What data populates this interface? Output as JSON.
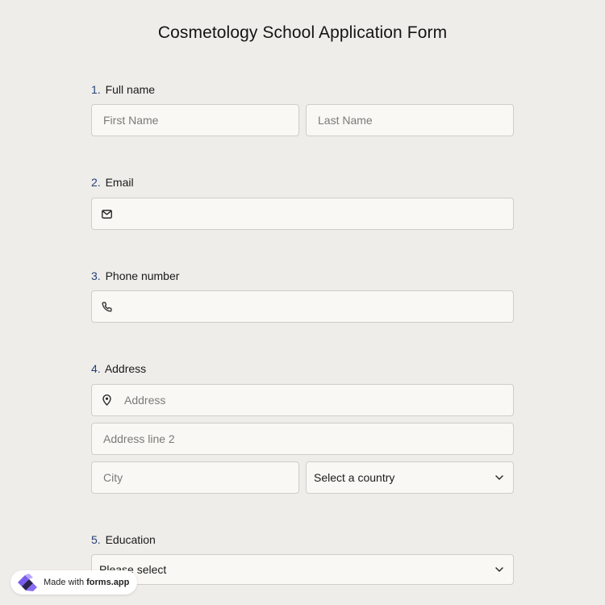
{
  "form": {
    "title": "Cosmetology School Application Form"
  },
  "questions": {
    "q1": {
      "number": "1.",
      "label": "Full name",
      "first_placeholder": "First Name",
      "last_placeholder": "Last Name"
    },
    "q2": {
      "number": "2.",
      "label": "Email",
      "value": "",
      "icon": "envelope-icon"
    },
    "q3": {
      "number": "3.",
      "label": "Phone number",
      "value": "",
      "icon": "phone-icon"
    },
    "q4": {
      "number": "4.",
      "label": "Address",
      "address_placeholder": "Address",
      "address_icon": "map-pin-icon",
      "address2_placeholder": "Address line 2",
      "city_placeholder": "City",
      "country_selected": "Select a country"
    },
    "q5": {
      "number": "5.",
      "label": "Education",
      "selected": "Please select"
    }
  },
  "badge": {
    "prefix": "Made with",
    "brand": "forms.app"
  },
  "colors": {
    "background": "#efede9",
    "input_background": "#f9f8f4",
    "input_border": "#cfcdc8",
    "question_number": "#24407a"
  }
}
